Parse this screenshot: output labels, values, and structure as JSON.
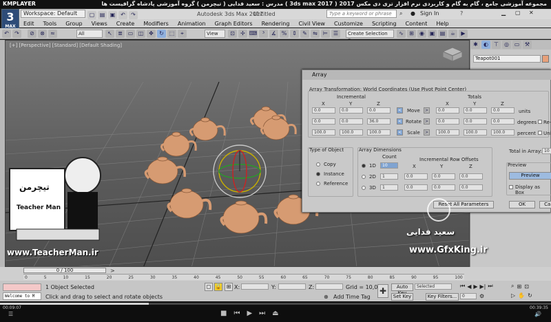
{
  "player": {
    "brand": "KMPLAYER",
    "course_title": "مجموعه آموزشی جامع ، گام به گام و کاربردی نرم افزار تری دی مکس 2017 ( 3ds max 2017 ) مدرس : سعید فدایی ( تیچرمن ) گروه آموزشی پادشاه گرافیست ها",
    "time_current": "00:09:07",
    "time_total": "00:39:35"
  },
  "app": {
    "logo_label": "3",
    "logo_sub": "MAX",
    "workspace": "Workspace: Default",
    "window_title": "Autodesk 3ds Max 2017",
    "doc_title": "Untitled",
    "search_placeholder": "Type a keyword or phrase",
    "sign_in": "Sign In",
    "menus": [
      "Edit",
      "Tools",
      "Group",
      "Views",
      "Create",
      "Modifiers",
      "Animation",
      "Graph Editors",
      "Rendering",
      "Civil View",
      "Customize",
      "Scripting",
      "Content",
      "Help"
    ],
    "toolbar": {
      "selection_filter": "All",
      "reference_coord": "View",
      "named_selection": "Create Selection Se"
    }
  },
  "viewport": {
    "label": "[+] [Perspective] [Standard] [Default Shading]"
  },
  "command_panel": {
    "object_name": "Teapot001",
    "object_color": "#e8a07a"
  },
  "dialog": {
    "title": "Array",
    "transform_title": "Array Transformation: World Coordinates (Use Pivot Point Center)",
    "incremental": "Incremental",
    "totals": "Totals",
    "axes": [
      "X",
      "Y",
      "Z"
    ],
    "rows": [
      {
        "name": "Move",
        "inc": [
          "0.0",
          "0.0",
          "0.0"
        ],
        "tot": [
          "0.0",
          "0.0",
          "0.0"
        ],
        "unit": "units"
      },
      {
        "name": "Rotate",
        "inc": [
          "0.0",
          "0.0",
          "36.0"
        ],
        "tot": [
          "0.0",
          "0.0",
          "0.0"
        ],
        "unit": "degrees",
        "extra": "Re-Orient"
      },
      {
        "name": "Scale",
        "inc": [
          "100.0",
          "100.0",
          "100.0"
        ],
        "tot": [
          "100.0",
          "100.0",
          "100.0"
        ],
        "unit": "percent",
        "extra": "Uniform"
      }
    ],
    "type_of_object": {
      "title": "Type of Object",
      "options": [
        "Copy",
        "Instance",
        "Reference"
      ],
      "selected": "Instance"
    },
    "array_dimensions": {
      "title": "Array Dimensions",
      "count_label": "Count",
      "row_offsets_label": "Incremental Row Offsets",
      "dims": [
        {
          "name": "1D",
          "count": "10"
        },
        {
          "name": "2D",
          "count": "1",
          "offsets": [
            "0.0",
            "0.0",
            "0.0"
          ]
        },
        {
          "name": "3D",
          "count": "1",
          "offsets": [
            "0.0",
            "0.0",
            "0.0"
          ]
        }
      ]
    },
    "total_in_array_label": "Total in Array:",
    "total_in_array": "10",
    "preview_title": "Preview",
    "preview_button": "Preview",
    "display_as_box": "Display as Box",
    "reset_button": "Reset All Parameters",
    "ok_button": "OK",
    "cancel_button": "Cancel"
  },
  "timeline": {
    "slider": "0 / 100",
    "ticks": [
      "0",
      "5",
      "10",
      "15",
      "20",
      "25",
      "30",
      "35",
      "40",
      "45",
      "50",
      "55",
      "60",
      "65",
      "70",
      "75",
      "80",
      "85",
      "90",
      "95",
      "100"
    ]
  },
  "status": {
    "selected": "1 Object Selected",
    "prompt": "Click and drag to select and rotate objects",
    "x_label": "X:",
    "y_label": "Y:",
    "z_label": "Z:",
    "grid": "Grid = 10,0",
    "add_time_tag": "Add Time Tag",
    "auto_key": "Auto Key",
    "selected_dd": "Selected",
    "set_key": "Set Key",
    "key_filters": "Key Filters...",
    "frame": "0",
    "welcome": "Welcome to M"
  },
  "watermark": {
    "brand_fa": "تیچرمن",
    "brand_en": "Teacher Man",
    "url": "www.TeacherMan.ir",
    "author": "سعید فدایی",
    "site": "www.GfxKing.ir"
  }
}
